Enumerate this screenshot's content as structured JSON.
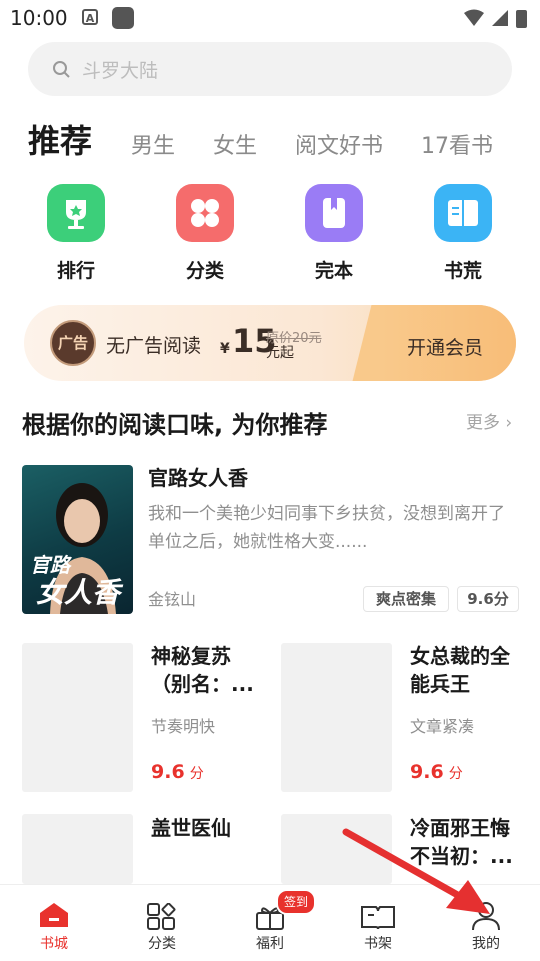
{
  "status": {
    "time": "10:00",
    "notif_icon_letter": "A"
  },
  "search": {
    "placeholder": "斗罗大陆"
  },
  "tabs": {
    "active": "推荐",
    "items": [
      "男生",
      "女生",
      "阅文好书",
      "17看书"
    ]
  },
  "categories": [
    {
      "label": "排行",
      "icon": "trophy-icon",
      "color": "#3ccf7a"
    },
    {
      "label": "分类",
      "icon": "grid-icon",
      "color": "#f56c6c"
    },
    {
      "label": "完本",
      "icon": "book-bookmark-icon",
      "color": "#9a7cf5"
    },
    {
      "label": "书荒",
      "icon": "open-book-icon",
      "color": "#3bb4f5"
    }
  ],
  "banner": {
    "badge": "广告",
    "text": "无广告阅读",
    "currency": "¥",
    "price": "15",
    "original": "原价20元",
    "suffix": "元起",
    "cta": "开通会员"
  },
  "section": {
    "title": "根据你的阅读口味, 为你推荐",
    "more": "更多"
  },
  "featured": {
    "title": "官路女人香",
    "desc": "我和一个美艳少妇同事下乡扶贫，没想到离开了单位之后，她就性格大变......",
    "author": "金铉山",
    "tag": "爽点密集",
    "score": "9.6分",
    "cover_text_1": "官路",
    "cover_text_2": "女人香"
  },
  "grid": [
    {
      "title": "神秘复苏（别名：...",
      "sub": "节奏明快",
      "score": "9.6",
      "unit": "分"
    },
    {
      "title": "女总裁的全能兵王",
      "sub": "文章紧凑",
      "score": "9.6",
      "unit": "分"
    },
    {
      "title": "盖世医仙",
      "sub": "",
      "score": "",
      "unit": ""
    },
    {
      "title": "冷面邪王悔不当初：...",
      "sub": "",
      "score": "",
      "unit": ""
    }
  ],
  "nav": {
    "items": [
      {
        "label": "书城",
        "icon": "store-home-icon",
        "active": true
      },
      {
        "label": "分类",
        "icon": "category-icon",
        "active": false
      },
      {
        "label": "福利",
        "icon": "gift-icon",
        "active": false
      },
      {
        "label": "书架",
        "icon": "bookshelf-icon",
        "active": false
      },
      {
        "label": "我的",
        "icon": "profile-icon",
        "active": false
      }
    ],
    "badge": "签到"
  },
  "colors": {
    "accent": "#e8322d",
    "banner_cta": "#f8bd78"
  }
}
